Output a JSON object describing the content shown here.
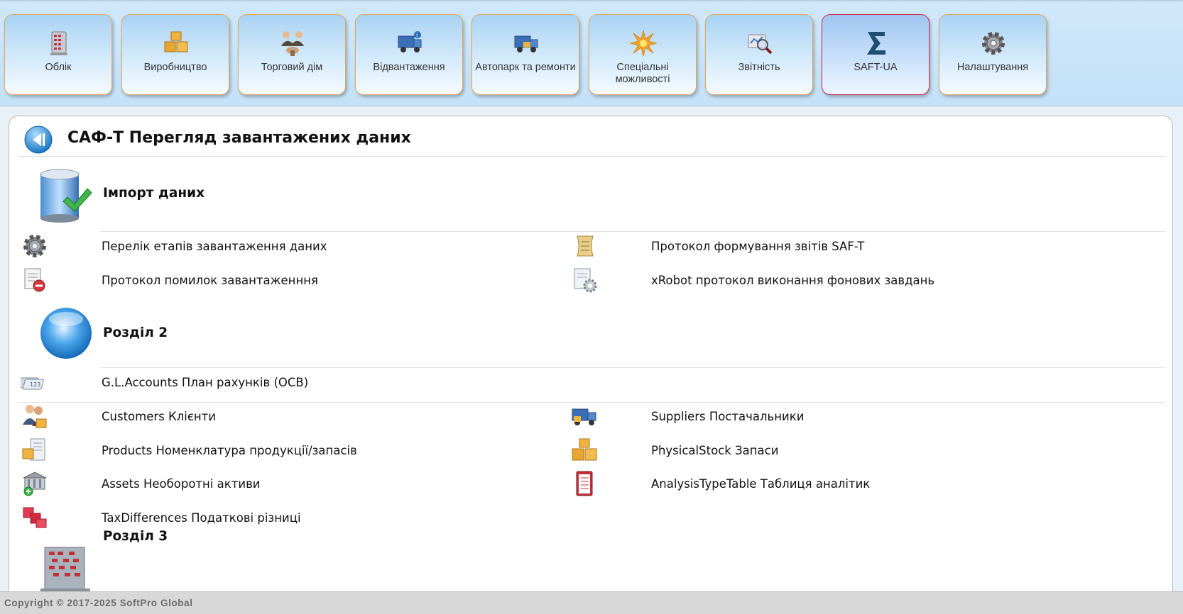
{
  "nav": {
    "tabs": [
      {
        "label": "Облік"
      },
      {
        "label": "Виробництво"
      },
      {
        "label": "Торговий дім"
      },
      {
        "label": "Відвантаження"
      },
      {
        "label": "Автопарк та ремонти"
      },
      {
        "label": "Спеціальні можливості"
      },
      {
        "label": "Звітність"
      },
      {
        "label": "SAFT-UA",
        "active": true
      },
      {
        "label": "Налаштування"
      }
    ],
    "active_border_color": "#d0254a",
    "tab_border_color": "#e0a85a"
  },
  "page": {
    "title": "САФ-Т Перегляд завантажених даних"
  },
  "sections": [
    {
      "title": "Імпорт даних",
      "icon": "database-import-icon",
      "items_left": [
        {
          "label": "Перелік етапів завантаження даних",
          "icon": "gear-icon"
        },
        {
          "label": "Протокол помилок завантаженння",
          "icon": "error-document-icon"
        }
      ],
      "items_right": [
        {
          "label": "Протокол формування звітів SAF-T",
          "icon": "scroll-icon"
        },
        {
          "label": "xRobot протокол виконання фонових завдань",
          "icon": "robot-document-icon"
        }
      ]
    },
    {
      "title": "Розділ 2",
      "icon": "blue-sphere-icon",
      "items_single": [
        {
          "label": "G.L.Accounts План рахунків (ОСВ)",
          "icon": "accounts-cards-icon"
        }
      ],
      "items_left": [
        {
          "label": "Customers Клієнти",
          "icon": "customers-icon"
        },
        {
          "label": "Products Номенклатура продукції/запасів",
          "icon": "products-icon"
        },
        {
          "label": "Assets Необоротні активи",
          "icon": "assets-icon"
        },
        {
          "label": "TaxDifferences Податкові різниці",
          "icon": "red-cubes-icon"
        }
      ],
      "items_right": [
        {
          "label": "Suppliers Постачальники",
          "icon": "truck-icon"
        },
        {
          "label": "PhysicalStock Запаси",
          "icon": "boxes-icon"
        },
        {
          "label": "AnalysisTypeTable Таблиця аналітик",
          "icon": "checklist-icon"
        }
      ]
    },
    {
      "title": "Розділ 3",
      "icon": "abacus-icon"
    }
  ],
  "footer": {
    "copyright": "Copyright © 2017-2025 SoftPro Global"
  }
}
